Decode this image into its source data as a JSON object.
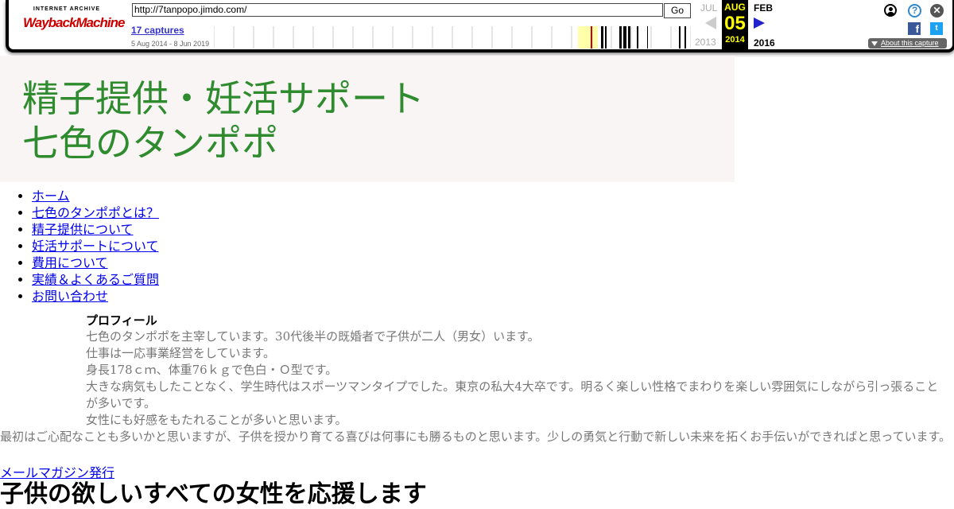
{
  "wayback": {
    "logo_top": "INTERNET ARCHIVE",
    "logo_main": "WaybackMachine",
    "url": "http://7tanpopo.jimdo.com/",
    "go_label": "Go",
    "captures_label": "17 captures",
    "capture_range": "5 Aug 2014 - 8 Jun 2019",
    "prev_month": "JUL",
    "prev_year": "2013",
    "current_month": "AUG",
    "current_day": "05",
    "current_year": "2014",
    "next_month": "FEB",
    "next_year": "2016",
    "about_label": "About this capture",
    "accent_color": "#ffff00",
    "icons": [
      "user-icon",
      "help-icon",
      "close-icon",
      "facebook-icon",
      "twitter-icon"
    ]
  },
  "site": {
    "title_line1": "精子提供・妊活サポート",
    "title_line2": "七色のタンポポ",
    "title_color": "#2e8b2e"
  },
  "nav": {
    "items": [
      "ホーム",
      "七色のタンポポとは？",
      "精子提供について",
      "妊活サポートについて",
      "費用について",
      "実績＆よくあるご質問",
      "お問い合わせ"
    ]
  },
  "profile": {
    "heading": "プロフィール",
    "lines": [
      "七色のタンポポを主宰しています。30代後半の既婚者で子供が二人（男女）います。",
      "仕事は一応事業経営をしています。",
      "身長178ｃｍ、体重76ｋｇで色白・Ｏ型です。",
      "大きな病気もしたことなく、学生時代はスポーツマンタイプでした。東京の私大4大卒です。明るく楽しい性格でまわりを楽しい雰囲気にしながら引っ張ることが多いです。",
      "女性にも好感をもたれることが多いと思います。"
    ]
  },
  "intro_paragraph": "最初はご心配なことも多いかと思いますが、子供を授かり育てる喜びは何事にも勝るものと思います。少しの勇気と行動で新しい未来を拓くお手伝いができればと思っています。",
  "mail_magazine_link": "メールマガジン発行",
  "main_heading": "子供の欲しいすべての女性を応援します"
}
